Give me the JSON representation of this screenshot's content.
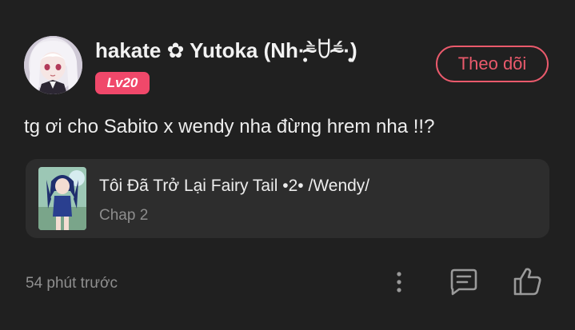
{
  "comment": {
    "user": {
      "name": "hakate ✿ Yutoka (Nh·̩̩̥͙⁼̴̀ꇴ⁼̴́·̩̩̥͙)",
      "level": "Lv20",
      "avatar_icon": "anime-girl-avatar"
    },
    "follow_label": "Theo dõi",
    "text": "tg ơi cho Sabito x wendy nha đừng hrem nha !!?",
    "story": {
      "title": "Tôi Đã Trở Lại Fairy Tail •2• /Wendy/",
      "chapter": "Chap 2",
      "cover_icon": "story-cover-image"
    },
    "timestamp": "54 phút trước",
    "actions": {
      "more_icon": "more-vertical-icon",
      "reply_icon": "message-square-icon",
      "like_icon": "thumbs-up-icon"
    }
  },
  "colors": {
    "background": "#202020",
    "card": "#2d2d2d",
    "accent": "#ea5a6c",
    "level_badge": "#f0486a",
    "muted_text": "#8f8f8f"
  }
}
